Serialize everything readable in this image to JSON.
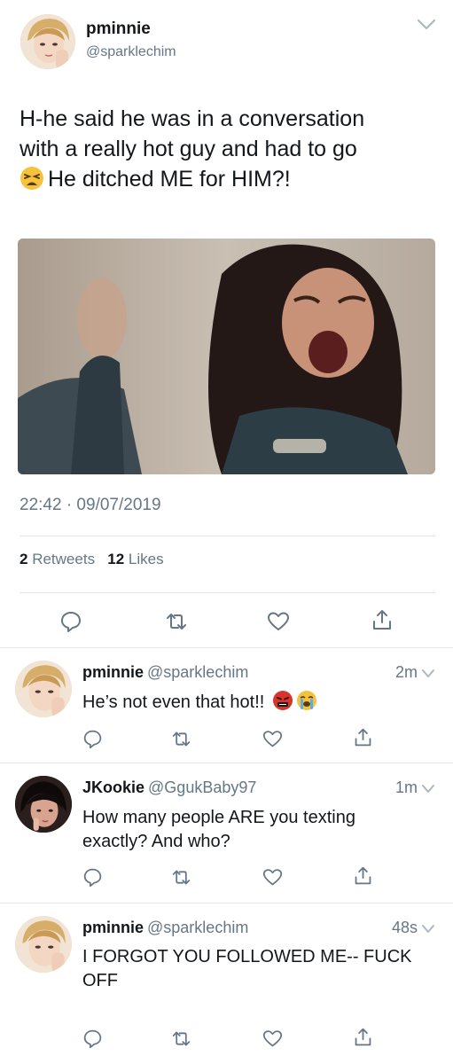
{
  "main_tweet": {
    "name": "pminnie",
    "handle": "@sparklechim",
    "text_line1": "H-he said he was in a conversation",
    "text_line2": "with a really hot guy and had to go",
    "text_line3": "He ditched ME for HIM?!",
    "emoji_name": "tired-face-emoji",
    "image_name": "crying-woman-photo",
    "timestamp": "22:42 · 09/07/2019",
    "retweets_count": "2",
    "retweets_label": "Retweets",
    "likes_count": "12",
    "likes_label": "Likes"
  },
  "replies": [
    {
      "name": "pminnie",
      "handle": "@sparklechim",
      "time": "2m",
      "text": "He’s not even that hot!!",
      "emojis": [
        "cursing-face-emoji",
        "loudly-crying-face-emoji"
      ]
    },
    {
      "name": "JKookie",
      "handle": "@GgukBaby97",
      "time": "1m",
      "text_line1": "How many people ARE you texting",
      "text_line2": "exactly? And who?"
    },
    {
      "name": "pminnie",
      "handle": "@sparklechim",
      "time": "48s",
      "text_line1": "I FORGOT YOU FOLLOWED ME-- FUCK",
      "text_line2": "OFF"
    }
  ],
  "icons": [
    "reply-icon",
    "retweet-icon",
    "like-icon",
    "share-icon",
    "chevron-down-icon"
  ],
  "colors": {
    "text": "#14171a",
    "secondary": "#657786",
    "divider": "#e1e8ed"
  }
}
